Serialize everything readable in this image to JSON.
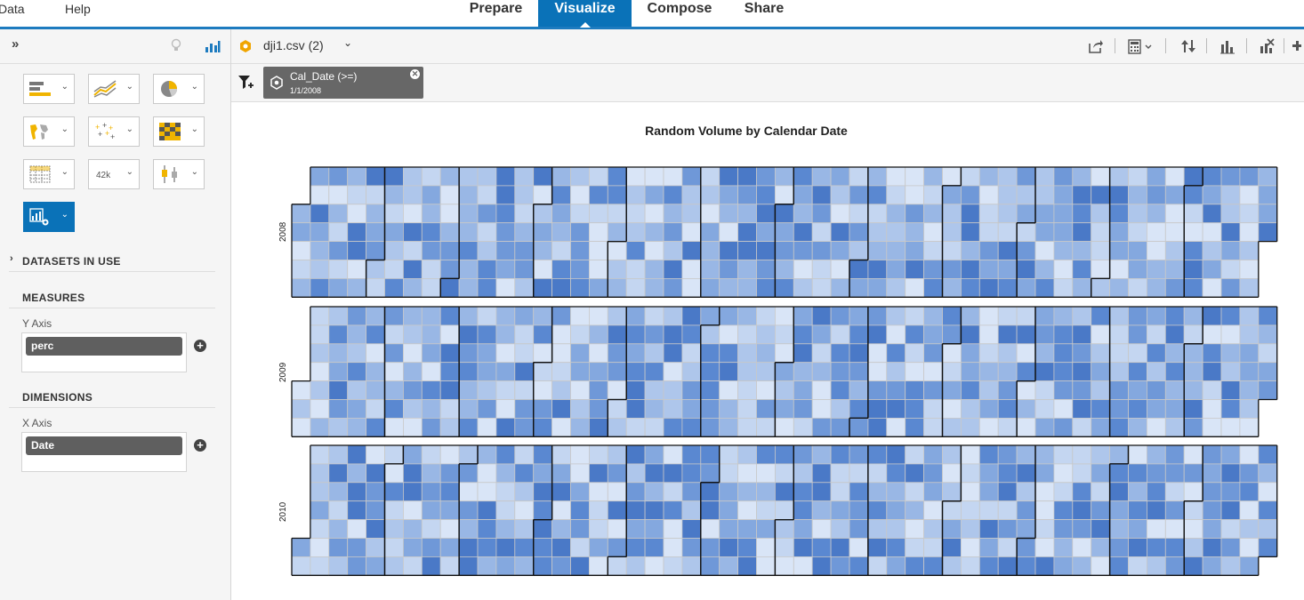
{
  "topnav": {
    "left_items": [
      "Data",
      "Help"
    ],
    "tabs": [
      {
        "label": "Prepare",
        "active": false
      },
      {
        "label": "Visualize",
        "active": true
      },
      {
        "label": "Compose",
        "active": false
      },
      {
        "label": "Share",
        "active": false
      }
    ]
  },
  "left_panel": {
    "collapse_glyph": "»",
    "viz_buttons": [
      "bar-chart-icon",
      "line-chart-icon",
      "pie-chart-icon",
      "geo-map-icon",
      "scatter-plot-icon",
      "heatmap-icon",
      "crosstab-icon",
      "numeric-point-icon",
      "box-plot-icon",
      "custom-chart-icon"
    ],
    "numeric_point_text": "42k",
    "datasets_label": "DATASETS IN USE",
    "measures_label": "MEASURES",
    "y_axis_label": "Y Axis",
    "y_axis_value": "perc",
    "dimensions_label": "DIMENSIONS",
    "x_axis_label": "X Axis",
    "x_axis_value": "Date"
  },
  "toolbar": {
    "dataset_name": "dji1.csv (2)",
    "icons": [
      "share-icon",
      "calculator-icon",
      "sort-icon",
      "ranking-icon",
      "remove-chart-icon"
    ]
  },
  "filter": {
    "field": "Cal_Date (>=)",
    "value": "1/1/2008"
  },
  "colors": {
    "accent": "#0a72b8",
    "heat_low": "#dce7f7",
    "heat_high": "#3f7ac9"
  },
  "chart_data": {
    "type": "heatmap",
    "title": "Random Volume by Calendar Date",
    "rows": [
      "2008",
      "2009",
      "2010"
    ],
    "layout": "calendar: 7 weekday rows × ~53 week columns per year, 12 month blocks outlined",
    "value_scale": "light blue (low) to dark blue (high)"
  }
}
